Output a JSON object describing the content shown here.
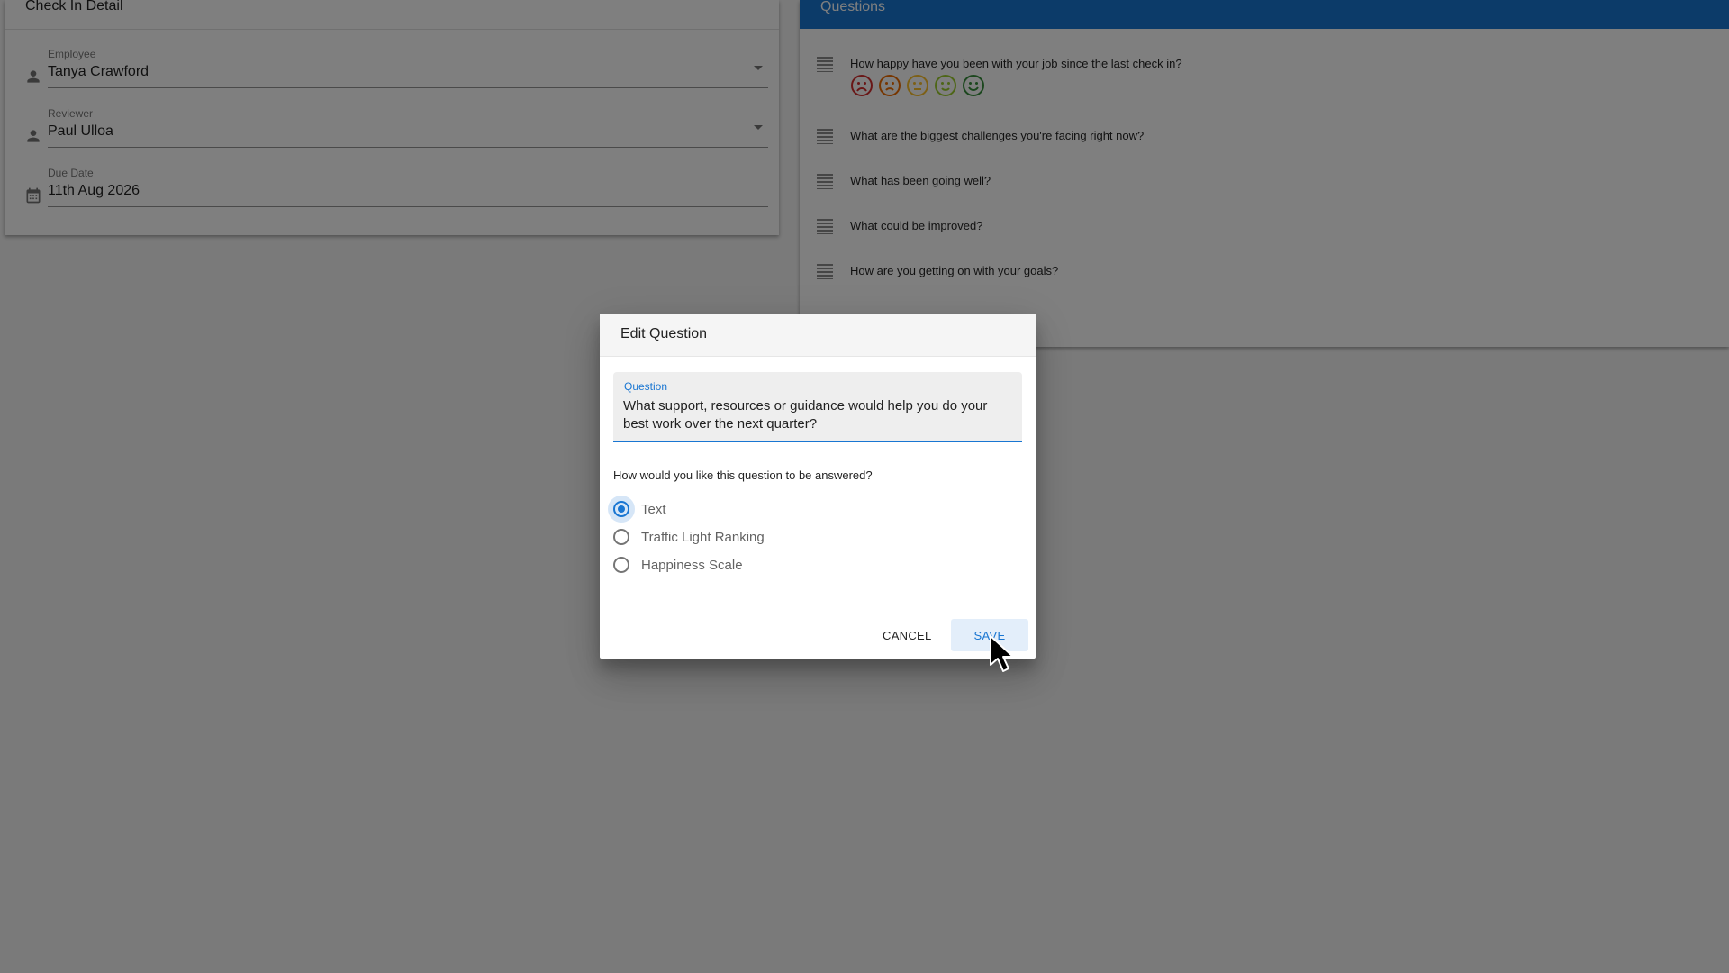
{
  "detail": {
    "title": "Check In Detail",
    "employee": {
      "label": "Employee",
      "value": "Tanya Crawford",
      "icon": "person-icon"
    },
    "reviewer": {
      "label": "Reviewer",
      "value": "Paul Ulloa",
      "icon": "person-icon"
    },
    "due_date": {
      "label": "Due Date",
      "value": "11th Aug 2026",
      "icon": "calendar-icon"
    }
  },
  "questions": {
    "title": "Questions",
    "items": [
      {
        "text": "How happy have you been with your job since the last check in?",
        "answer_type": "happiness-scale"
      },
      {
        "text": "What are the biggest challenges you're facing right now?"
      },
      {
        "text": "What has been going well?"
      },
      {
        "text": "What could be improved?"
      },
      {
        "text": "How are you getting on with your goals?"
      }
    ],
    "faces": [
      {
        "name": "very-sad-face-icon",
        "color": "#d32f2f"
      },
      {
        "name": "sad-face-icon",
        "color": "#ef6c00"
      },
      {
        "name": "neutral-face-icon",
        "color": "#fbc02d"
      },
      {
        "name": "happy-face-icon",
        "color": "#9ccc2f"
      },
      {
        "name": "very-happy-face-icon",
        "color": "#388e3c"
      }
    ]
  },
  "dialog": {
    "title": "Edit Question",
    "question_label": "Question",
    "question_value": "What support, resources or guidance would help you do your best work over the next quarter?",
    "answer_prompt": "How would you like this question to be answered?",
    "options": [
      {
        "label": "Text",
        "selected": true
      },
      {
        "label": "Traffic Light Ranking",
        "selected": false
      },
      {
        "label": "Happiness Scale",
        "selected": false
      }
    ],
    "cancel_label": "CANCEL",
    "save_label": "SAVE"
  },
  "colors": {
    "primary": "#1976d2",
    "backdrop": "rgba(0,0,0,0.5)"
  }
}
